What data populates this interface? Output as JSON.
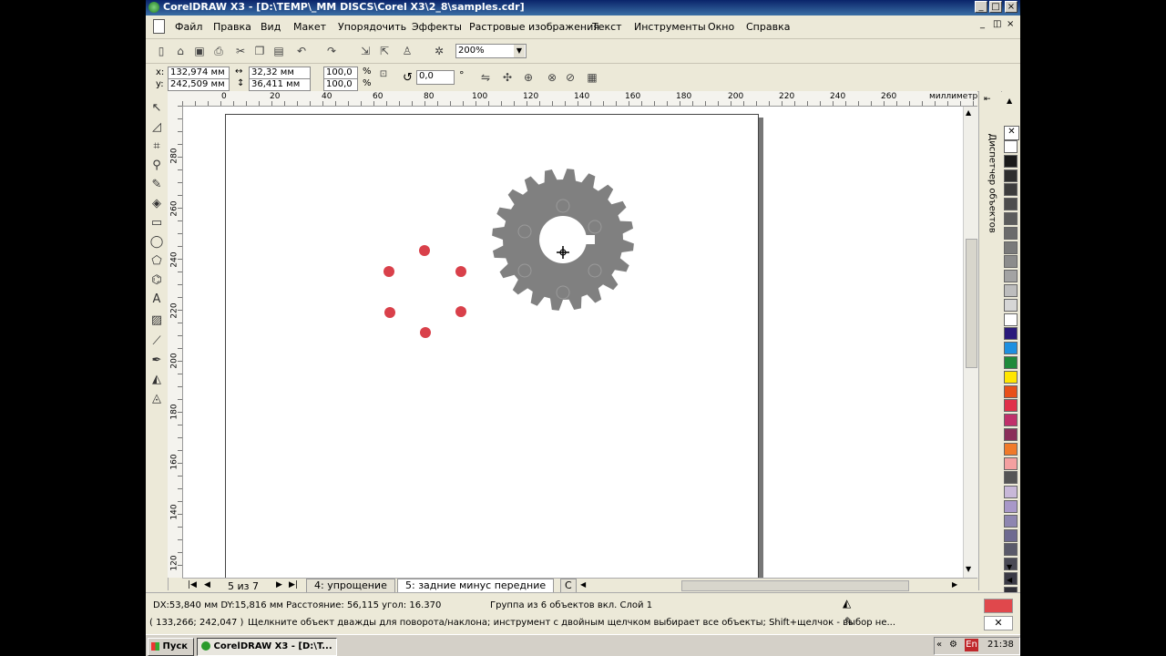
{
  "window": {
    "title": "CorelDRAW X3 - [D:\\TEMP\\_MM DISCS\\Corel X3\\2_8\\samples.cdr]"
  },
  "menu": [
    "Файл",
    "Правка",
    "Вид",
    "Макет",
    "Упорядочить",
    "Эффекты",
    "Растровые изображения",
    "Текст",
    "Инструменты",
    "Окно",
    "Справка"
  ],
  "toolbar": {
    "zoom": "200%"
  },
  "property_bar": {
    "x_label": "x:",
    "x_value": "132,974 мм",
    "y_label": "y:",
    "y_value": "242,509 мм",
    "width_value": "32,32 мм",
    "height_value": "36,411 мм",
    "scale_x": "100,0",
    "scale_y": "100,0",
    "percent": "%",
    "rotation": "0,0",
    "degree": "°"
  },
  "ruler": {
    "h_ticks": [
      "0",
      "20",
      "40",
      "60",
      "80",
      "100",
      "120",
      "140",
      "160",
      "180",
      "200",
      "220",
      "240",
      "260"
    ],
    "v_ticks": [
      "280",
      "260",
      "240",
      "220",
      "200",
      "180",
      "160",
      "140",
      "120"
    ],
    "unit": "миллиметры"
  },
  "pages": {
    "counter": "5 из 7",
    "tabs": [
      "4: упрощение",
      "5: задние минус передние",
      "С"
    ]
  },
  "docker": {
    "title": "Диспетчер объектов"
  },
  "status": {
    "line1": "DX:53,840 мм DY:15,816 мм Расстояние: 56,115 угол: 16.370",
    "selection": "Группа из 6 объектов вкл. Слой 1",
    "coords": "( 133,266; 242,047 )",
    "hint": "Щелкните объект дважды для поворота/наклона; инструмент с двойным щелчком выбирает все объекты; Shift+щелчок - выбор не...",
    "fill_color": "#e0484c"
  },
  "taskbar": {
    "start": "Пуск",
    "app": "CorelDRAW X3 - [D:\\T...",
    "lang": "En",
    "clock": "21:38"
  },
  "colors": {
    "gear": "#808080",
    "dots": "#d9404a",
    "palette": [
      "#ffffff",
      "#1a1a1a",
      "#2e2e2e",
      "#3d3d3d",
      "#4d4d4d",
      "#5c5c5c",
      "#6b6b6b",
      "#7a7a7a",
      "#8c8c8c",
      "#a3a3a3",
      "#bdbdbd",
      "#d6d6d6",
      "#ffffff",
      "#2a1a7a",
      "#1e90e0",
      "#1f8a3a",
      "#ffe600",
      "#e8501a",
      "#e0304a",
      "#c0306a",
      "#8a2e5a",
      "#f07a2a",
      "#f4a0a0",
      "#555555",
      "#c8b8d8",
      "#a898c8",
      "#8e86b0",
      "#6e6a90",
      "#5a5a6a",
      "#4a4a55",
      "#3a3a45",
      "#303038"
    ]
  }
}
